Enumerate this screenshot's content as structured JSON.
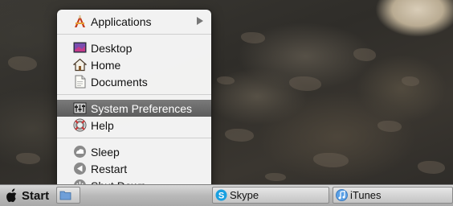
{
  "start_menu": {
    "items": [
      {
        "label": "Applications",
        "icon": "applications-icon",
        "has_submenu": true
      },
      {
        "label": "Desktop",
        "icon": "desktop-icon"
      },
      {
        "label": "Home",
        "icon": "home-icon"
      },
      {
        "label": "Documents",
        "icon": "documents-icon"
      },
      {
        "label": "System Preferences",
        "icon": "system-preferences-icon",
        "selected": true
      },
      {
        "label": "Help",
        "icon": "help-icon"
      },
      {
        "label": "Sleep",
        "icon": "sleep-icon"
      },
      {
        "label": "Restart",
        "icon": "restart-icon"
      },
      {
        "label": "Shut Down",
        "icon": "shut-down-icon"
      }
    ]
  },
  "taskbar": {
    "start_label": "Start",
    "start_icon": "apple-icon",
    "tasks": [
      {
        "label": "",
        "icon": "folder-icon"
      },
      {
        "label": "Skype",
        "icon": "skype-icon"
      },
      {
        "label": "iTunes",
        "icon": "itunes-icon"
      }
    ]
  },
  "colors": {
    "menu_background": "#f6f6f6",
    "selection": "#6a6a6a",
    "taskbar": "#bdbdbd"
  }
}
